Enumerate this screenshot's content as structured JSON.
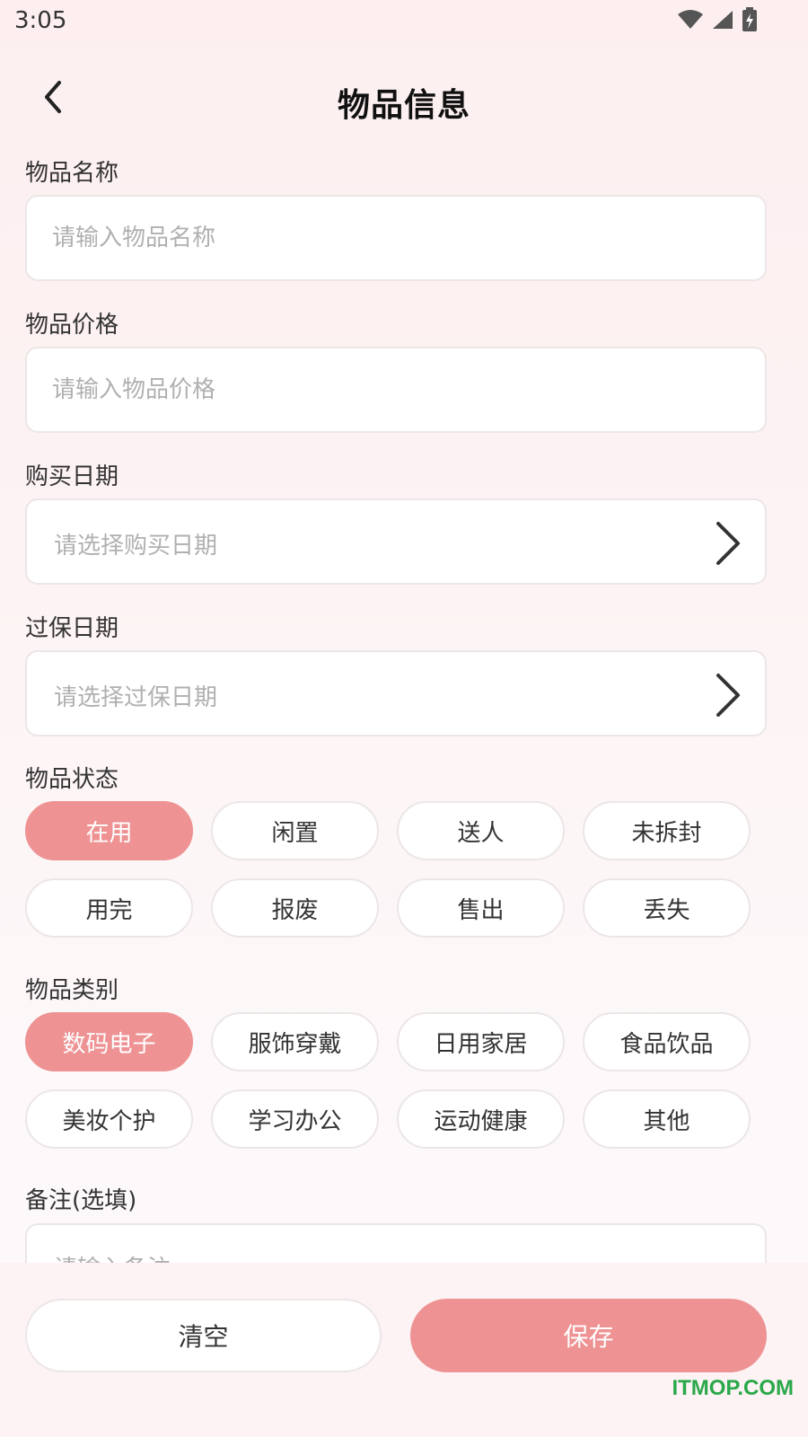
{
  "status_bar": {
    "time": "3:05",
    "icons": [
      "wifi-icon",
      "signal-icon",
      "battery-charging-icon"
    ]
  },
  "header": {
    "title": "物品信息",
    "back_icon": "chevron-left-icon"
  },
  "fields": {
    "name": {
      "label": "物品名称",
      "placeholder": "请输入物品名称"
    },
    "price": {
      "label": "物品价格",
      "placeholder": "请输入物品价格"
    },
    "purchase_date": {
      "label": "购买日期",
      "placeholder": "请选择购买日期"
    },
    "expire_date": {
      "label": "过保日期",
      "placeholder": "请选择过保日期"
    },
    "remark": {
      "label": "备注(选填)",
      "placeholder": "请输入备注"
    }
  },
  "status": {
    "label": "物品状态",
    "options": [
      "在用",
      "闲置",
      "送人",
      "未拆封",
      "用完",
      "报废",
      "售出",
      "丢失"
    ],
    "selected": "在用"
  },
  "category": {
    "label": "物品类别",
    "options": [
      "数码电子",
      "服饰穿戴",
      "日用家居",
      "食品饮品",
      "美妆个护",
      "学习办公",
      "运动健康",
      "其他"
    ],
    "selected": "数码电子"
  },
  "actions": {
    "clear": "清空",
    "save": "保存"
  },
  "watermark": "ITMOP.COM",
  "colors": {
    "accent": "#ee9293",
    "background": "#fdf3f4",
    "border": "#ece6e7",
    "placeholder": "#b0b0b0",
    "watermark": "#2aa84a"
  }
}
